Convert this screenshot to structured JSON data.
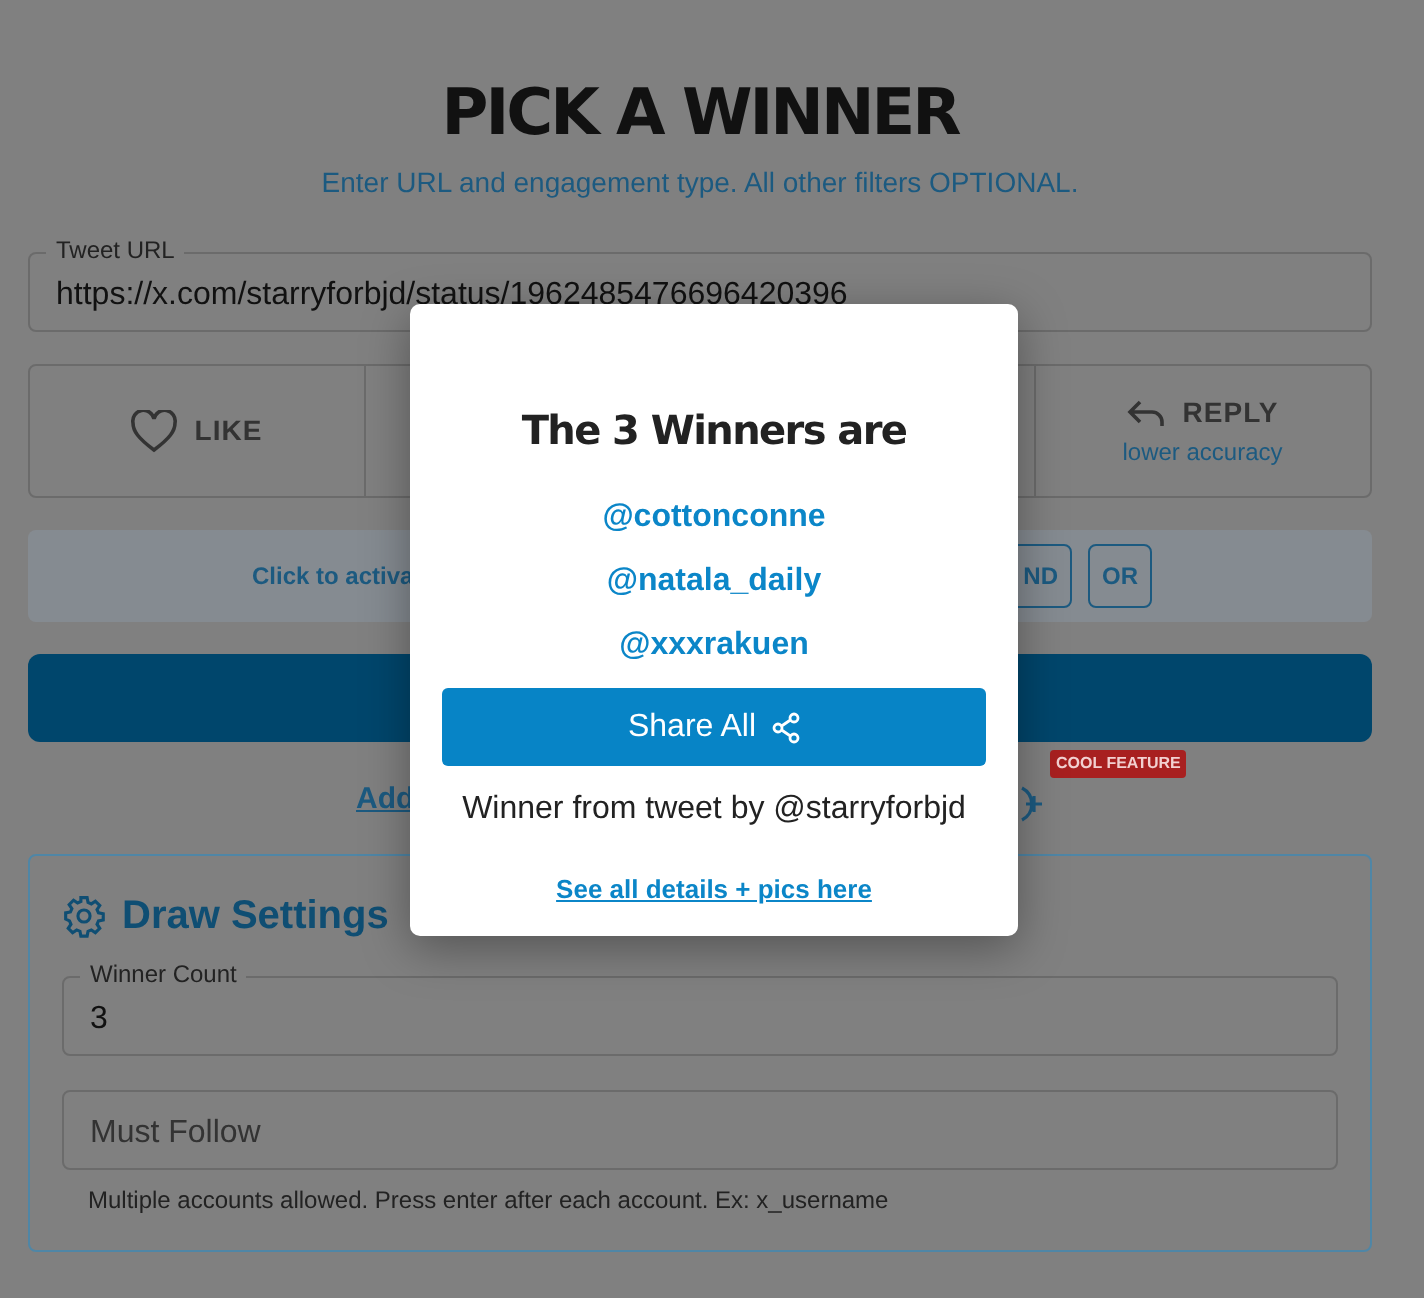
{
  "header": {
    "title": "PICK A WINNER",
    "subtitle": "Enter URL and engagement type. All other filters OPTIONAL."
  },
  "tweet_url": {
    "label": "Tweet URL",
    "value": "https://x.com/starryforbjd/status/1962485476696420396"
  },
  "engagement": [
    {
      "kind": "like",
      "label": "LIKE"
    },
    {
      "kind": "covered"
    },
    {
      "kind": "covered"
    },
    {
      "kind": "reply",
      "label": "REPLY",
      "note": "lower accuracy"
    }
  ],
  "filter_bar": {
    "text": "Click to activa",
    "operators": [
      "ND",
      "OR"
    ]
  },
  "add_row": {
    "link": "Add",
    "badge": "COOL FEATURE"
  },
  "draw_settings": {
    "title": "Draw Settings",
    "fields": [
      {
        "label": "Winner Count",
        "value": "3"
      },
      {
        "placeholder": "Must Follow"
      }
    ],
    "help": "Multiple accounts allowed. Press enter after each account. Ex: x_username"
  },
  "modal": {
    "title": "The 3 Winners are",
    "winners": [
      "@cottonconne",
      "@natala_daily",
      "@xxxrakuen"
    ],
    "share_button": "Share All",
    "caption": "Winner from tweet by @starryforbjd",
    "details_link": "See all details + pics here"
  }
}
